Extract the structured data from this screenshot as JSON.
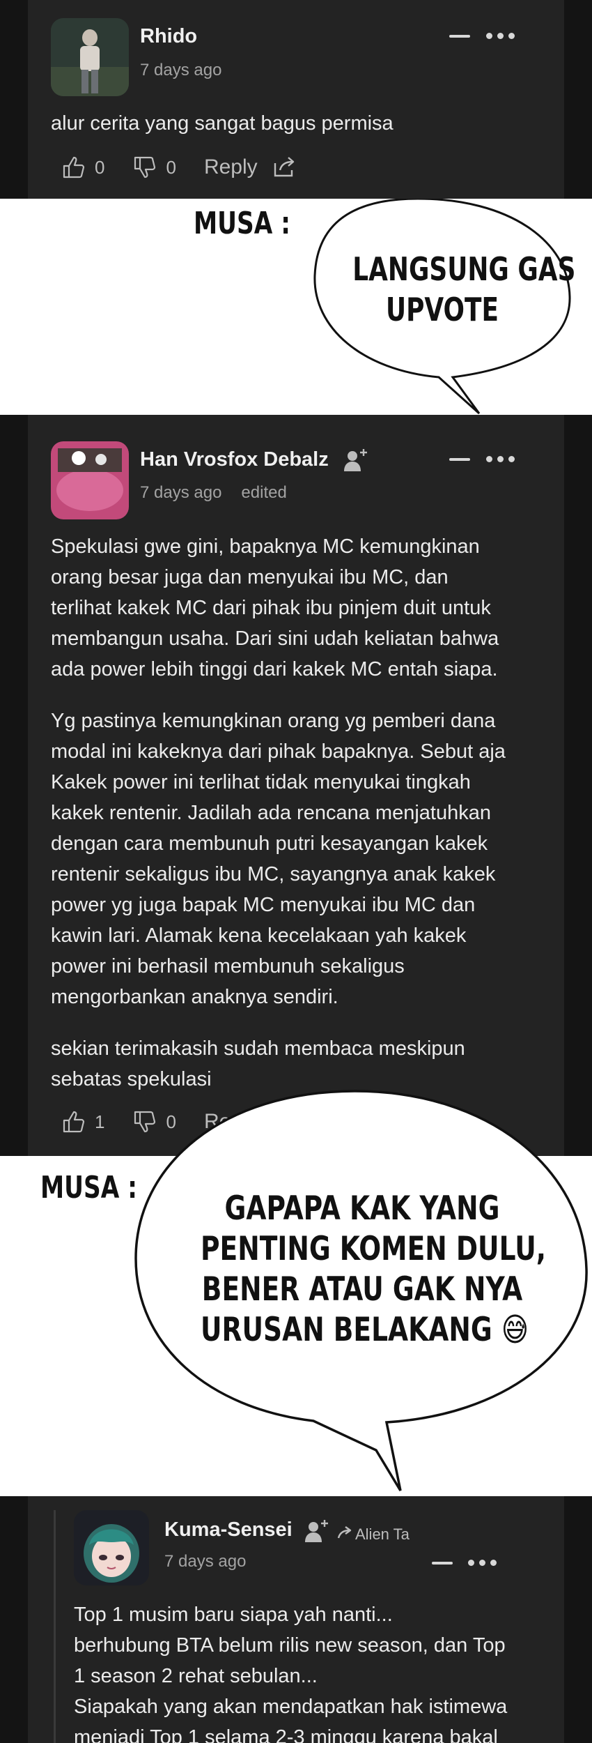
{
  "comments": [
    {
      "username": "Rhido",
      "time": "7 days ago",
      "text": "alur cerita yang sangat bagus permisa",
      "likes": "0",
      "dislikes": "0",
      "reply_label": "Reply"
    },
    {
      "username": "Han Vrosfox Debalz",
      "time": "7 days ago",
      "edited": "edited",
      "paragraphs": [
        [
          "Spekulasi gwe gini, bapaknya MC kemungkinan",
          "orang besar juga dan menyukai ibu MC, dan",
          "terlihat kakek MC dari pihak ibu pinjem duit untuk",
          "membangun usaha. Dari sini udah keliatan bahwa",
          "ada power lebih tinggi dari kakek MC entah siapa."
        ],
        [
          "Yg pastinya kemungkinan orang yg pemberi dana",
          "modal ini kakeknya dari pihak bapaknya. Sebut aja",
          "Kakek power ini terlihat tidak menyukai tingkah",
          "kakek rentenir. Jadilah ada rencana menjatuhkan",
          "dengan cara membunuh putri kesayangan kakek",
          "rentenir sekaligus ibu MC, sayangnya anak kakek",
          "power yg juga bapak MC menyukai ibu MC dan",
          "kawin lari. Alamak kena kecelakaan yah kakek",
          "power ini berhasil membunuh sekaligus",
          "mengorbankan anaknya sendiri."
        ],
        [
          "sekian terimakasih sudah membaca meskipun",
          "sebatas spekulasi"
        ]
      ],
      "likes": "1",
      "dislikes": "0",
      "reply_label": "Re"
    },
    {
      "username": "Kuma-Sensei",
      "badge": "Alien Ta",
      "time": "7 days ago",
      "lines": [
        "Top 1 musim baru siapa yah nanti...",
        "berhubung BTA belum rilis new season, dan Top",
        "1 season 2 rehat sebulan...",
        "Siapakah yang akan mendapatkan hak istimewa",
        "menjadi Top 1 selama 2-3 minggu karena bakal"
      ]
    }
  ],
  "panels": [
    {
      "speaker": "MUSA :",
      "bubble_lines": [
        "LANGSUNG GAS",
        "UPVOTE"
      ]
    },
    {
      "speaker": "MUSA :",
      "bubble_lines": [
        "GAPAPA KAK YANG",
        "PENTING KOMEN DULU,",
        "BENER ATAU GAK NYA",
        "URUSAN BELAKANG"
      ],
      "emoji": "😅"
    }
  ],
  "colors": {
    "background": "#141414",
    "card": "#232323",
    "text": "#ececec",
    "muted": "#a3a3a3",
    "manga_bg": "#ffffff"
  }
}
